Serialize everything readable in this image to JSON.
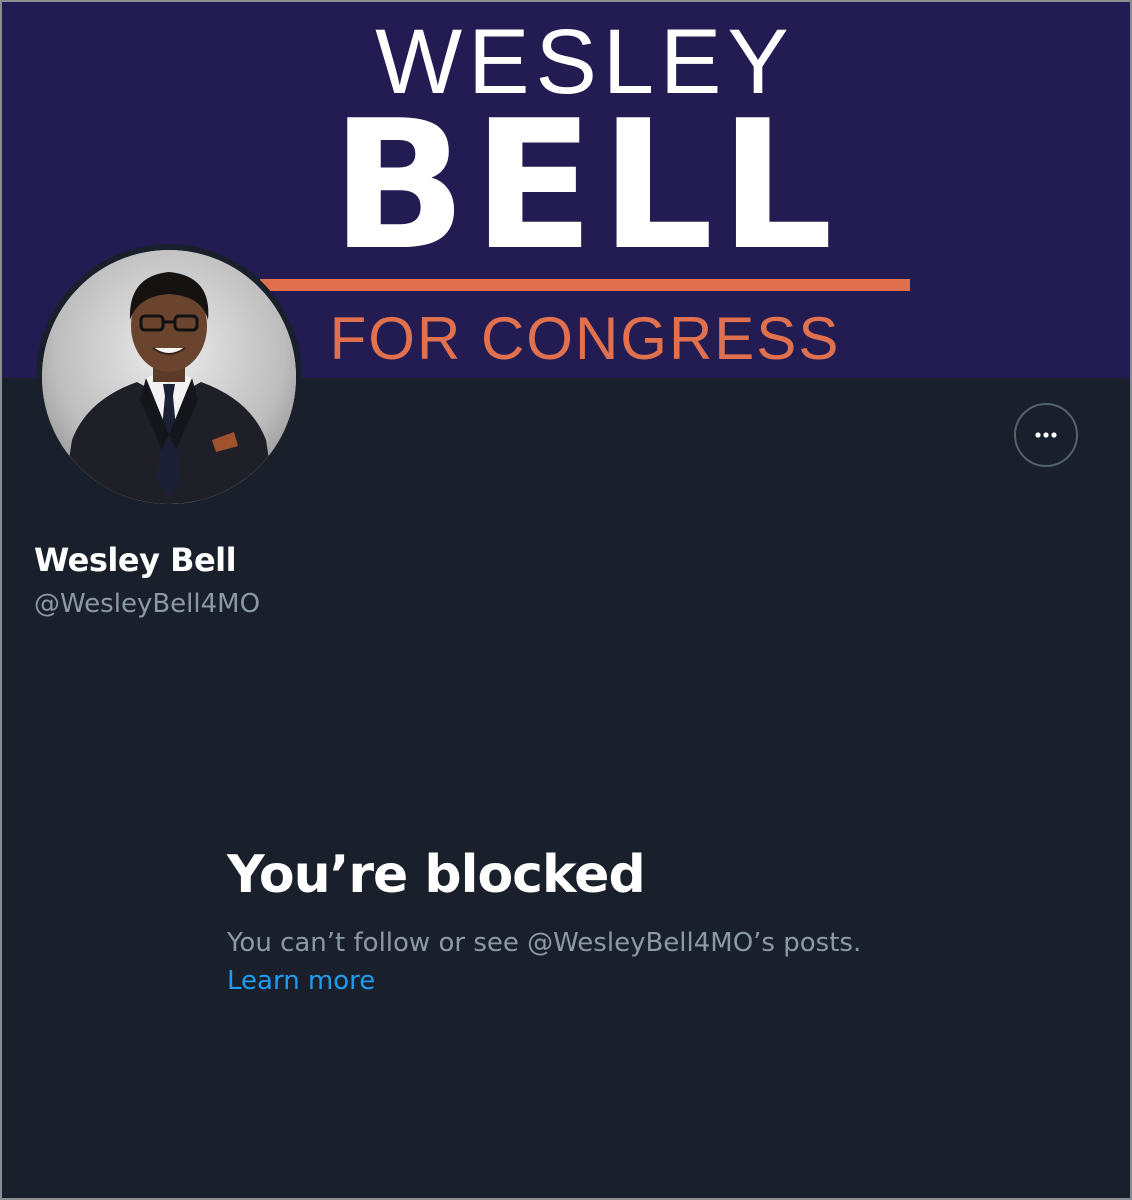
{
  "banner": {
    "line1": "WESLEY",
    "line2": "BELL",
    "line3": "FOR CONGRESS",
    "background_color": "#221c52",
    "accent_color": "#e0704e"
  },
  "profile": {
    "display_name": "Wesley Bell",
    "handle": "@WesleyBell4MO",
    "more_icon": "more-horizontal-icon"
  },
  "blocked": {
    "title": "You’re blocked",
    "description": "You can’t follow or see @WesleyBell4MO’s posts.",
    "learn_more": "Learn more",
    "link_color": "#1d9bf0"
  },
  "theme": {
    "background": "#1a202b",
    "secondary_text": "#8b98a5"
  }
}
